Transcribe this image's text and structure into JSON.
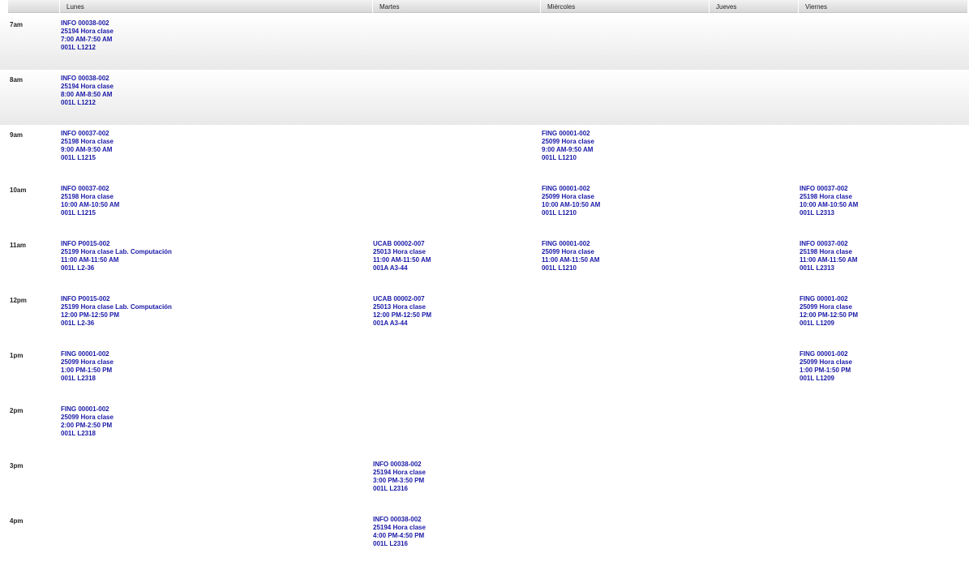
{
  "headers": [
    "",
    "Lunes",
    "Martes",
    "Miércoles",
    "Jueves",
    "Viernes"
  ],
  "rows": [
    {
      "time": "7am",
      "shaded": true,
      "entries": [
        {
          "col": 1,
          "lines": [
            "INFO 00038-002",
            "25194 Hora clase",
            "7:00 AM-7:50 AM",
            "001L L1212"
          ]
        }
      ]
    },
    {
      "time": "8am",
      "shaded": true,
      "entries": [
        {
          "col": 1,
          "lines": [
            "INFO 00038-002",
            "25194 Hora clase",
            "8:00 AM-8:50 AM",
            "001L L1212"
          ]
        }
      ]
    },
    {
      "time": "9am",
      "shaded": false,
      "entries": [
        {
          "col": 1,
          "lines": [
            "INFO 00037-002",
            "25198 Hora clase",
            "9:00 AM-9:50 AM",
            "001L L1215"
          ]
        },
        {
          "col": 3,
          "lines": [
            "FING 00001-002",
            "25099 Hora clase",
            "9:00 AM-9:50 AM",
            "001L L1210"
          ]
        }
      ]
    },
    {
      "time": "10am",
      "shaded": false,
      "entries": [
        {
          "col": 1,
          "lines": [
            "INFO 00037-002",
            "25198 Hora clase",
            "10:00 AM-10:50 AM",
            "001L L1215"
          ]
        },
        {
          "col": 3,
          "lines": [
            "FING 00001-002",
            "25099 Hora clase",
            "10:00 AM-10:50 AM",
            "001L L1210"
          ]
        },
        {
          "col": 5,
          "lines": [
            "INFO 00037-002",
            "25198 Hora clase",
            "10:00 AM-10:50 AM",
            "001L L2313"
          ]
        }
      ]
    },
    {
      "time": "11am",
      "shaded": false,
      "entries": [
        {
          "col": 1,
          "lines": [
            "INFO P0015-002",
            "25199 Hora clase Lab. Computación",
            "11:00 AM-11:50 AM",
            "001L L2-36"
          ]
        },
        {
          "col": 2,
          "lines": [
            "UCAB 00002-007",
            "25013 Hora clase",
            "11:00 AM-11:50 AM",
            "001A A3-44"
          ]
        },
        {
          "col": 3,
          "lines": [
            "FING 00001-002",
            "25099 Hora clase",
            "11:00 AM-11:50 AM",
            "001L L1210"
          ]
        },
        {
          "col": 5,
          "lines": [
            "INFO 00037-002",
            "25198 Hora clase",
            "11:00 AM-11:50 AM",
            "001L L2313"
          ]
        }
      ]
    },
    {
      "time": "12pm",
      "shaded": false,
      "entries": [
        {
          "col": 1,
          "lines": [
            "INFO P0015-002",
            "25199 Hora clase Lab. Computación",
            "12:00 PM-12:50 PM",
            "001L L2-36"
          ]
        },
        {
          "col": 2,
          "lines": [
            "UCAB 00002-007",
            "25013 Hora clase",
            "12:00 PM-12:50 PM",
            "001A A3-44"
          ]
        },
        {
          "col": 5,
          "lines": [
            "FING 00001-002",
            "25099 Hora clase",
            "12:00 PM-12:50 PM",
            "001L L1209"
          ]
        }
      ]
    },
    {
      "time": "1pm",
      "shaded": false,
      "entries": [
        {
          "col": 1,
          "lines": [
            "FING 00001-002",
            "25099 Hora clase",
            "1:00 PM-1:50 PM",
            "001L L2318"
          ]
        },
        {
          "col": 5,
          "lines": [
            "FING 00001-002",
            "25099 Hora clase",
            "1:00 PM-1:50 PM",
            "001L L1209"
          ]
        }
      ]
    },
    {
      "time": "2pm",
      "shaded": false,
      "entries": [
        {
          "col": 1,
          "lines": [
            "FING 00001-002",
            "25099 Hora clase",
            "2:00 PM-2:50 PM",
            "001L L2318"
          ]
        }
      ]
    },
    {
      "time": "3pm",
      "shaded": false,
      "entries": [
        {
          "col": 2,
          "lines": [
            "INFO 00038-002",
            "25194 Hora clase",
            "3:00 PM-3:50 PM",
            "001L L2316"
          ]
        }
      ]
    },
    {
      "time": "4pm",
      "shaded": false,
      "entries": [
        {
          "col": 2,
          "lines": [
            "INFO 00038-002",
            "25194 Hora clase",
            "4:00 PM-4:50 PM",
            "001L L2316"
          ]
        }
      ]
    }
  ]
}
